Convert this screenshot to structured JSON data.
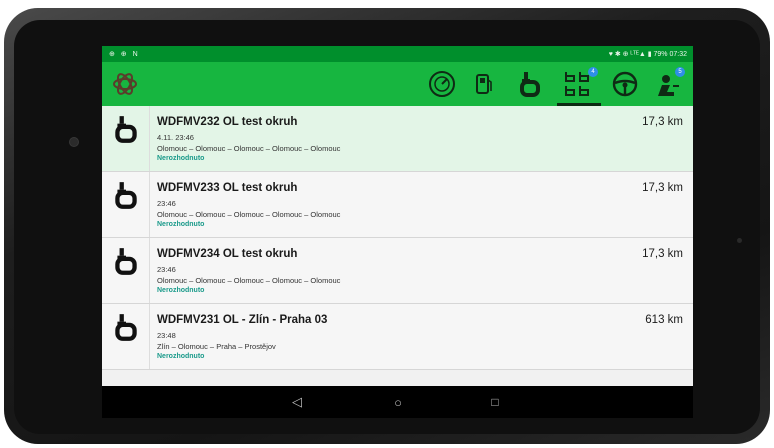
{
  "status_bar": {
    "left_icons": "⊕ ⊕ N",
    "right_text": "♥ ✱ ⊕ ᴸᵀᴱ▲ ▮ 79% 07:32"
  },
  "toolbar": {
    "icons": [
      "logo-icon",
      "speedometer-icon",
      "fuel-icon",
      "route-icon",
      "routes-list-icon",
      "steering-wheel-icon",
      "driver-icon"
    ],
    "badges": {
      "routes_list": "4",
      "driver": "5"
    },
    "active_tab": "routes-list",
    "colors": {
      "toolbar": "#17b640",
      "statusbar": "#008f2c",
      "accent_text": "#1a9a8a"
    }
  },
  "routes": [
    {
      "title": "WDFMV232 OL test okruh",
      "time": "4.11. 23:46",
      "route": "Olomouc – Olomouc – Olomouc – Olomouc – Olomouc",
      "state": "Nerozhodnuto",
      "distance": "17,3 km",
      "selected": true
    },
    {
      "title": "WDFMV233 OL test okruh",
      "time": "23:46",
      "route": "Olomouc – Olomouc – Olomouc – Olomouc – Olomouc",
      "state": "Nerozhodnuto",
      "distance": "17,3 km",
      "selected": false
    },
    {
      "title": "WDFMV234 OL test okruh",
      "time": "23:46",
      "route": "Olomouc – Olomouc – Olomouc – Olomouc – Olomouc",
      "state": "Nerozhodnuto",
      "distance": "17,3 km",
      "selected": false
    },
    {
      "title": "WDFMV231 OL - Zlín - Praha 03",
      "time": "23:48",
      "route": "Zlín – Olomouc – Praha – Prostějov",
      "state": "Nerozhodnuto",
      "distance": "613 km",
      "selected": false
    }
  ],
  "nav": {
    "back": "◁",
    "home": "○",
    "recents": "□"
  }
}
